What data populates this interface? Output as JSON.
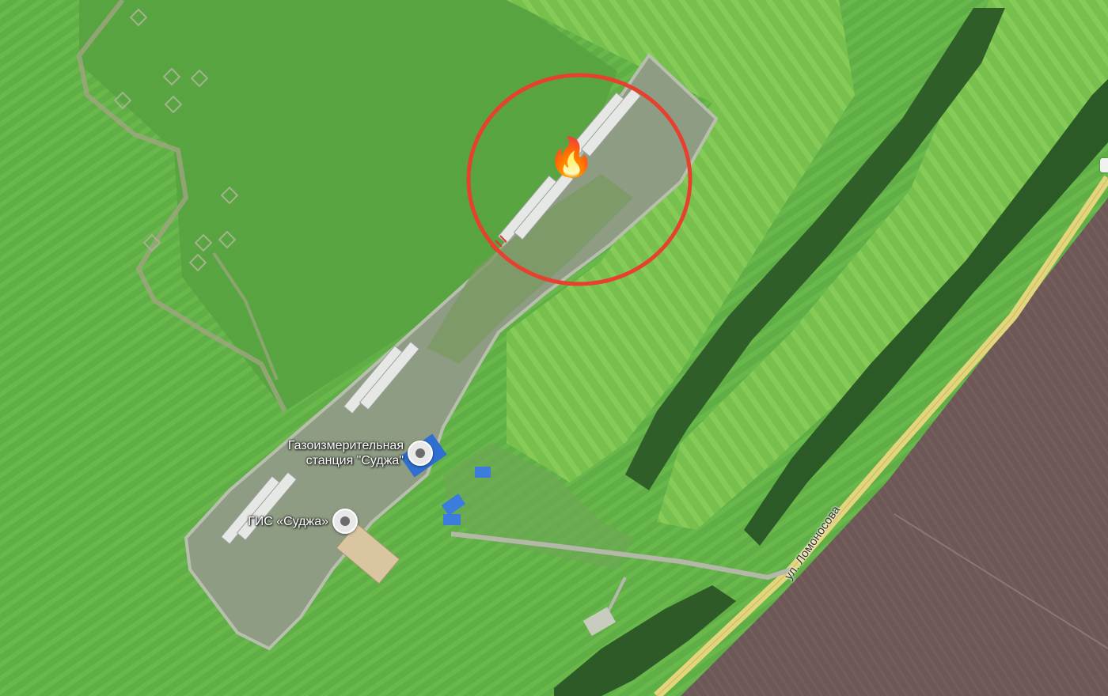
{
  "map": {
    "view": "satellite",
    "labels": {
      "station_line1": "Газоизмерительная",
      "station_line2": "станция \"Суджа\"",
      "gis": "ГИС «Суджа»",
      "street": "ул. Ломоносова"
    },
    "annotation": {
      "emoji": "🔥",
      "emoji_name": "fire-icon",
      "circle_color": "#e8402f"
    },
    "colors": {
      "field_green": "#5aa845",
      "light_field": "#8cc84f",
      "facility_gray": "#8d9a80",
      "plowed_field": "#6e5a58",
      "road_yellow": "#e5d77e",
      "forest": "#2e5a28"
    }
  }
}
